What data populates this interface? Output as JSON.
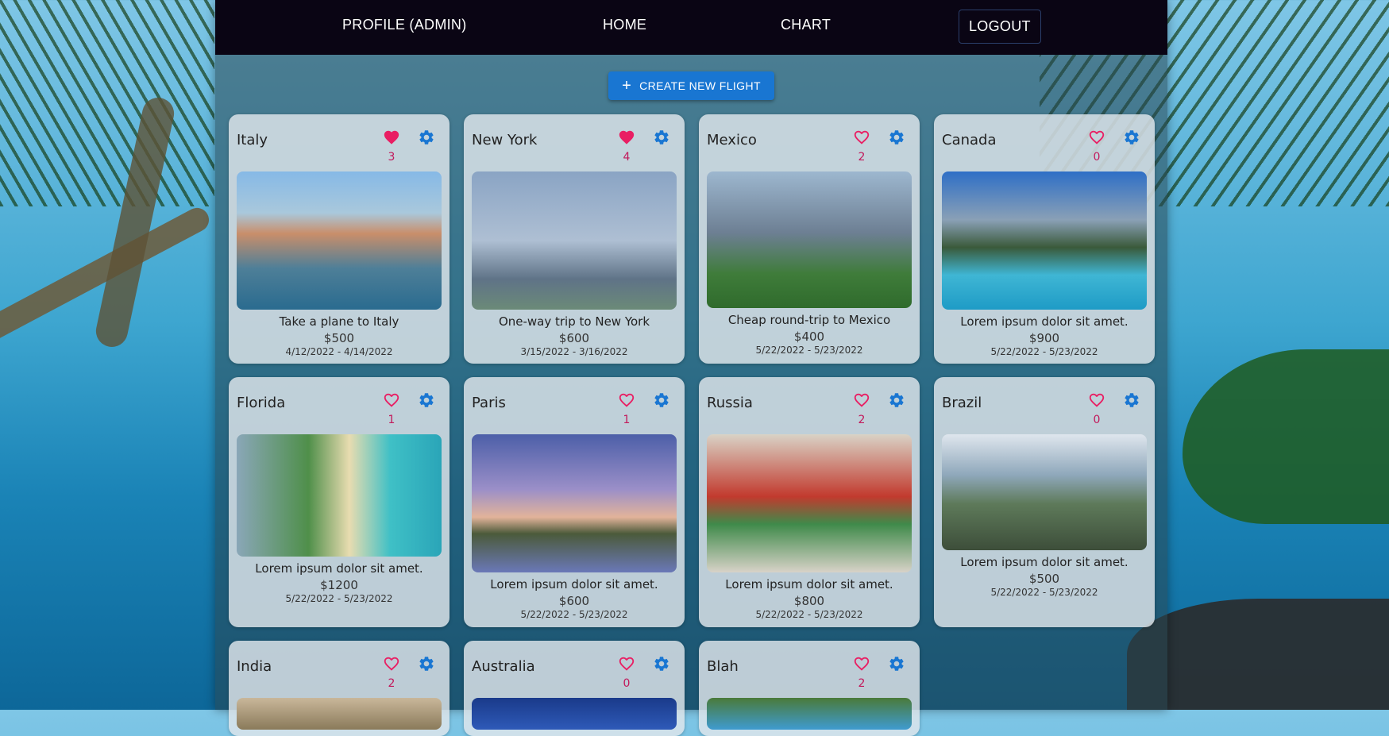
{
  "nav": {
    "profile": "PROFILE (ADMIN)",
    "home": "HOME",
    "chart": "CHART",
    "logout": "LOGOUT"
  },
  "create_button": "CREATE NEW FLIGHT",
  "accent_color": "#1976d2",
  "like_color": "#e91e63",
  "cards": [
    {
      "title": "Italy",
      "likes": "3",
      "liked": true,
      "description": "Take a plane to Italy",
      "price": "$500",
      "dates": "4/12/2022 - 4/14/2022",
      "image": "amalfi-coast-photo"
    },
    {
      "title": "New York",
      "likes": "4",
      "liked": true,
      "description": "One-way trip to New York",
      "price": "$600",
      "dates": "3/15/2022 - 3/16/2022",
      "image": "statue-of-liberty-photo"
    },
    {
      "title": "Mexico",
      "likes": "2",
      "liked": false,
      "description": "Cheap round-trip to Mexico",
      "price": "$400",
      "dates": "5/22/2022 - 5/23/2022",
      "image": "mexico-city-angel-photo"
    },
    {
      "title": "Canada",
      "likes": "0",
      "liked": false,
      "description": "Lorem ipsum dolor sit amet.",
      "price": "$900",
      "dates": "5/22/2022 - 5/23/2022",
      "image": "moraine-lake-photo"
    },
    {
      "title": "Florida",
      "likes": "1",
      "liked": false,
      "description": "Lorem ipsum dolor sit amet.",
      "price": "$1200",
      "dates": "5/22/2022 - 5/23/2022",
      "image": "miami-beach-photo"
    },
    {
      "title": "Paris",
      "likes": "1",
      "liked": false,
      "description": "Lorem ipsum dolor sit amet.",
      "price": "$600",
      "dates": "5/22/2022 - 5/23/2022",
      "image": "eiffel-tower-photo"
    },
    {
      "title": "Russia",
      "likes": "2",
      "liked": false,
      "description": "Lorem ipsum dolor sit amet.",
      "price": "$800",
      "dates": "5/22/2022 - 5/23/2022",
      "image": "st-basils-cathedral-photo"
    },
    {
      "title": "Brazil",
      "likes": "0",
      "liked": false,
      "description": "Lorem ipsum dolor sit amet.",
      "price": "$500",
      "dates": "5/22/2022 - 5/23/2022",
      "image": "christ-the-redeemer-photo"
    },
    {
      "title": "India",
      "likes": "2",
      "liked": false,
      "image": "india-photo"
    },
    {
      "title": "Australia",
      "likes": "0",
      "liked": false,
      "image": "australia-photo"
    },
    {
      "title": "Blah",
      "likes": "2",
      "liked": false,
      "image": "blah-photo"
    }
  ]
}
